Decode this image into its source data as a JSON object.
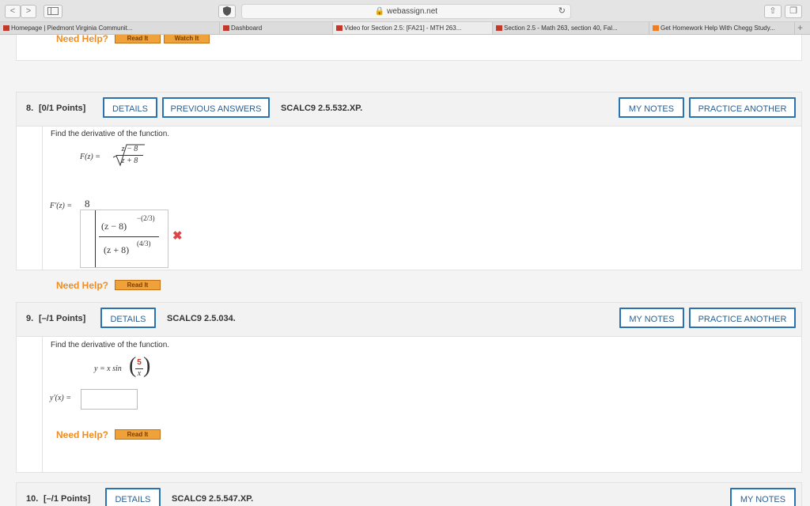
{
  "browser": {
    "url": "webassign.net",
    "tabs": [
      {
        "label": "Homepage | Piedmont Virginia Communit...",
        "fav_color": "#c0392b"
      },
      {
        "label": "Dashboard",
        "fav_color": "#c0392b"
      },
      {
        "label": "Video for Section 2.5: [FA21] - MTH 263...",
        "fav_color": "#c0392b"
      },
      {
        "label": "Section 2.5 - Math 263, section 40, Fal...",
        "fav_color": "#c0392b"
      },
      {
        "label": "Get Homework Help With Chegg Study...",
        "fav_color": "#ef7d22"
      }
    ]
  },
  "prev": {
    "need_help": "Need Help?",
    "read_it": "Read It",
    "watch_it": "Watch It"
  },
  "q8": {
    "number": "8.",
    "points": "[0/1 Points]",
    "details": "DETAILS",
    "previous_answers": "PREVIOUS ANSWERS",
    "code": "SCALC9 2.5.532.XP.",
    "my_notes": "MY NOTES",
    "practice_another": "PRACTICE ANOTHER",
    "prompt": "Find the derivative of the function.",
    "func_lhs": "F(z) =",
    "func_num": "z − 8",
    "func_den": "z + 8",
    "answer_lhs": "F′(z) =",
    "answer_coef": "8",
    "answer_num": "(z − 8)",
    "answer_num_exp": "−(2/3)",
    "answer_den": "(z + 8)",
    "answer_den_exp": "(4/3)",
    "mark": "✖",
    "need_help": "Need Help?",
    "read_it": "Read It"
  },
  "q9": {
    "number": "9.",
    "points": "[–/1 Points]",
    "details": "DETAILS",
    "code": "SCALC9 2.5.034.",
    "my_notes": "MY NOTES",
    "practice_another": "PRACTICE ANOTHER",
    "prompt": "Find the derivative of the function.",
    "func": "y = x sin",
    "frac_num": "5",
    "frac_den": "x",
    "answer_lhs": "y′(x) =",
    "answer_value": "",
    "need_help": "Need Help?",
    "read_it": "Read It"
  },
  "q10": {
    "number": "10.",
    "points": "[–/1 Points]",
    "details": "DETAILS",
    "code": "SCALC9 2.5.547.XP.",
    "my_notes": "MY NOTES"
  }
}
